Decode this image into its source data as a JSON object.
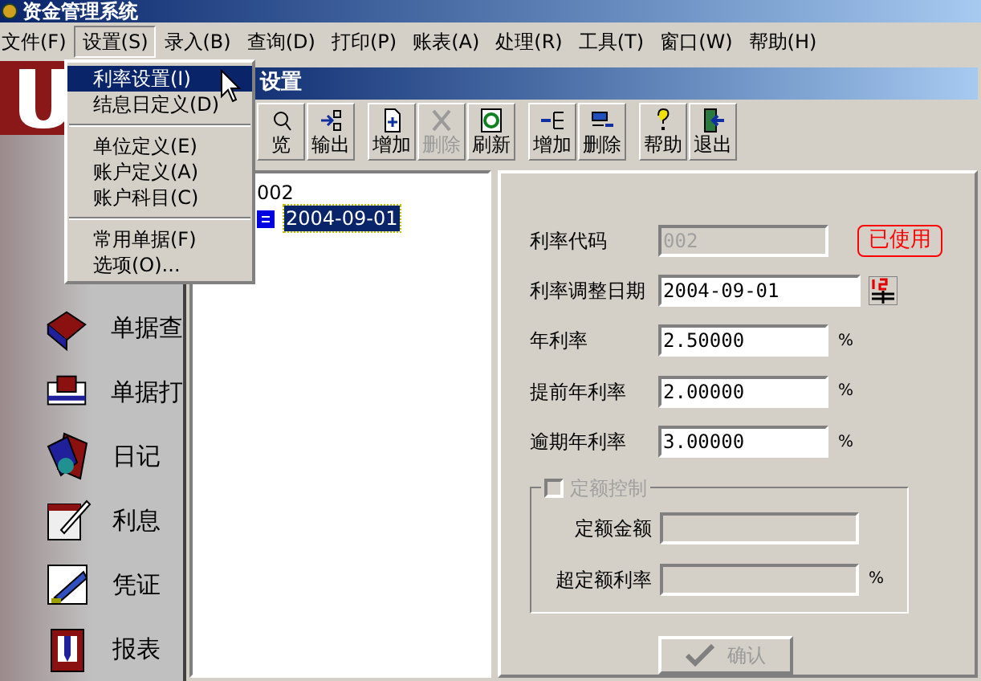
{
  "window": {
    "title": "资金管理系统"
  },
  "menu_bar": [
    {
      "label": "文件(F)",
      "selected": false
    },
    {
      "label": "设置(S)",
      "selected": true
    },
    {
      "label": "录入(B)",
      "selected": false
    },
    {
      "label": "查询(D)",
      "selected": false
    },
    {
      "label": "打印(P)",
      "selected": false
    },
    {
      "label": "账表(A)",
      "selected": false
    },
    {
      "label": "处理(R)",
      "selected": false
    },
    {
      "label": "工具(T)",
      "selected": false
    },
    {
      "label": "窗口(W)",
      "selected": false
    },
    {
      "label": "帮助(H)",
      "selected": false
    }
  ],
  "dropdown": [
    {
      "kind": "item",
      "label": "利率设置(I)",
      "selected": true
    },
    {
      "kind": "item",
      "label": "结息日定义(D)",
      "selected": false
    },
    {
      "kind": "separator"
    },
    {
      "kind": "item",
      "label": "单位定义(E)",
      "selected": false
    },
    {
      "kind": "item",
      "label": "账户定义(A)",
      "selected": false
    },
    {
      "kind": "item",
      "label": "账户科目(C)",
      "selected": false
    },
    {
      "kind": "separator"
    },
    {
      "kind": "item",
      "label": "常用单据(F)",
      "selected": false
    },
    {
      "kind": "item",
      "label": "选项(O)...",
      "selected": false
    }
  ],
  "sidebar": {
    "items": [
      {
        "label": "单据查"
      },
      {
        "label": "单据打"
      },
      {
        "label": "日记"
      },
      {
        "label": "利息"
      },
      {
        "label": "凭证"
      },
      {
        "label": "报表"
      }
    ]
  },
  "child_window": {
    "title": "设置"
  },
  "toolbar": [
    {
      "kind": "button",
      "label": "览",
      "disabled": false
    },
    {
      "kind": "button",
      "label": "输出",
      "disabled": false
    },
    {
      "kind": "separator"
    },
    {
      "kind": "button",
      "label": "增加",
      "disabled": false
    },
    {
      "kind": "button",
      "label": "删除",
      "disabled": true
    },
    {
      "kind": "button",
      "label": "刷新",
      "disabled": false
    },
    {
      "kind": "separator"
    },
    {
      "kind": "button",
      "label": "增加",
      "disabled": false
    },
    {
      "kind": "button",
      "label": "删除",
      "disabled": false
    },
    {
      "kind": "separator"
    },
    {
      "kind": "button",
      "label": "帮助",
      "disabled": false
    },
    {
      "kind": "button",
      "label": "退出",
      "disabled": false
    }
  ],
  "tree": [
    {
      "label": "002",
      "selected": false,
      "children": [
        {
          "label": "2004-09-01",
          "selected": true
        }
      ]
    }
  ],
  "form": {
    "fields": [
      {
        "label": "利率代码",
        "value": "002",
        "disabled": true,
        "badge": "已使用"
      },
      {
        "label": "利率调整日期",
        "value": "2004-09-01",
        "disabled": false,
        "calendar": true
      },
      {
        "label": "年利率",
        "value": "2.50000",
        "disabled": false,
        "unit": "%"
      },
      {
        "label": "提前年利率",
        "value": "2.00000",
        "disabled": false,
        "unit": "%"
      },
      {
        "label": "逾期年利率",
        "value": "3.00000",
        "disabled": false,
        "unit": "%"
      }
    ],
    "group": {
      "label": "定额控制",
      "checked": false,
      "disabled": true,
      "fields": [
        {
          "label": "定额金额"
        },
        {
          "label": "超定额利率",
          "unit": "%"
        }
      ]
    },
    "confirm": {
      "label": "确认",
      "disabled": true
    }
  }
}
